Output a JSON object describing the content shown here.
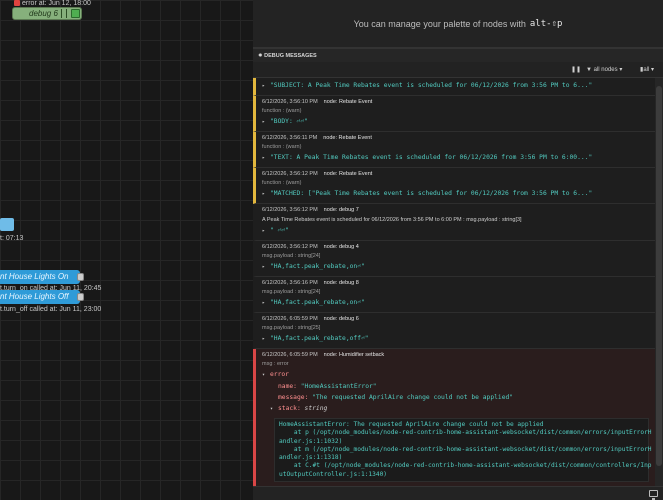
{
  "workspace": {
    "error_status": "error at: Jun 12, 18:00",
    "debug_node_label": "debug 6",
    "time_label": "t: 07:13",
    "nodes": [
      {
        "label": "nt House Lights On",
        "status": "t.turn_on called at: Jun 11, 20:45"
      },
      {
        "label": "nt House Lights Off",
        "status": "t.turn_off called at: Jun 11, 23:00"
      }
    ]
  },
  "palette_bar": {
    "text": "You can manage your palette of nodes with",
    "shortcut": "alt-⇧p"
  },
  "sidebar": {
    "header": "DEBUG MESSAGES",
    "toolbar": {
      "filter_label": "all nodes",
      "clear_label": "all"
    }
  },
  "messages": [
    {
      "kind": "warn",
      "body": "\"SUBJECT: A Peak Time Rebates event is scheduled for 06/12/2026 from 3:56 PM to 6...\""
    },
    {
      "kind": "warn",
      "time": "6/12/2026, 3:56:10 PM",
      "node": "node: Rebate Event",
      "sub": "function : (warn)",
      "body": "\"BODY:  ⏎⏎\""
    },
    {
      "kind": "warn",
      "time": "6/12/2026, 3:56:11 PM",
      "node": "node: Rebate Event",
      "sub": "function : (warn)",
      "body": "\"TEXT: A Peak Time Rebates event is scheduled for 06/12/2026 from 3:56 PM to 6:00...\""
    },
    {
      "kind": "warn",
      "time": "6/12/2026, 3:56:12 PM",
      "node": "node: Rebate Event",
      "sub": "function : (warn)",
      "body": "\"MATCHED: [\"Peak Time Rebates event is scheduled for 06/12/2026 from 3:56 PM to 6...\""
    },
    {
      "kind": "plain",
      "time": "6/12/2026, 3:56:12 PM",
      "node": "node: debug 7",
      "text": "A Peak Time Rebates event is scheduled for 06/12/2026 from 3:56 PM to 6:00 PM : msg.payload : string[3]",
      "body": "\" ⏎⏎\""
    },
    {
      "kind": "plain",
      "time": "6/12/2026, 3:56:12 PM",
      "node": "node: debug 4",
      "sub": "msg.payload : string[24]",
      "body": "\"HA,fact.peak_rebate,on⏎\""
    },
    {
      "kind": "plain",
      "time": "6/12/2026, 3:56:16 PM",
      "node": "node: debug 8",
      "sub": "msg.payload : string[24]",
      "body": "\"HA,fact.peak_rebate,on⏎\""
    },
    {
      "kind": "plain",
      "time": "6/12/2026, 6:05:59 PM",
      "node": "node: debug 6",
      "sub": "msg.payload : string[25]",
      "body": "\"HA,fact.peak_rebate,off⏎\""
    }
  ],
  "error_message": {
    "time": "6/12/2026, 6:05:59 PM",
    "node": "node: Humidifier setback",
    "sub": "msg : error",
    "root_key": "error",
    "name_key": "name:",
    "name_val": "\"HomeAssistantError\"",
    "message_key": "message:",
    "message_val": "\"The requested AprilAire change could not be applied\"",
    "stack_key": "stack:",
    "stack_type": "string",
    "stack_text": "HomeAssistantError: The requested AprilAire change could not be applied\n    at p (/opt/node_modules/node-red-contrib-home-assistant-websocket/dist/common/errors/inputErrorH\nandler.js:1:1032)\n    at m (/opt/node_modules/node-red-contrib-home-assistant-websocket/dist/common/errors/inputErrorH\nandler.js:1:1318)\n    at C.#t (/opt/node_modules/node-red-contrib-home-assistant-websocket/dist/common/controllers/Inp\nutOutputController.js:1:1340)"
  }
}
